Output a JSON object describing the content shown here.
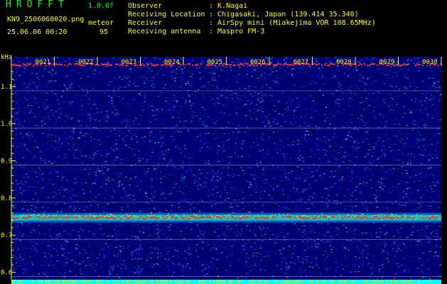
{
  "app": {
    "title": "HROFFT",
    "version": "1.0.0f",
    "filename": "KN9_2506060020.png",
    "datetime": "25.06.06 00:20",
    "meteor_label": "meteor",
    "meteor_count": "95"
  },
  "info": [
    {
      "key": "Observer",
      "value": "K.Nagai"
    },
    {
      "key": "Receiving Location",
      "value": "Chigasaki, Japan (139.414 35.340)"
    },
    {
      "key": "Receiver",
      "value": "AirSpy mini (Miakejima VOR 108.65MHz)"
    },
    {
      "key": "Receiving antenna",
      "value": "Maspro FM-3"
    }
  ],
  "spectrogram": {
    "unit_label": "kHz",
    "y_ticks": [
      "1.1",
      "1.0",
      "0.9",
      "0.8",
      "0.7",
      "0.6"
    ],
    "y_tick_values": [
      1.1,
      1.0,
      0.9,
      0.8,
      0.7,
      0.6
    ],
    "freq_range_khz": [
      0.58,
      1.18
    ],
    "time_labels": [
      "0021",
      "0022",
      "0023",
      "0024",
      "0025",
      "0026",
      "0027",
      "0028",
      "0029",
      "0030"
    ],
    "carrier_khz": 0.747,
    "colors": {
      "axis": "#ffff00",
      "grid": "#ffffff",
      "background": "#000070"
    }
  }
}
